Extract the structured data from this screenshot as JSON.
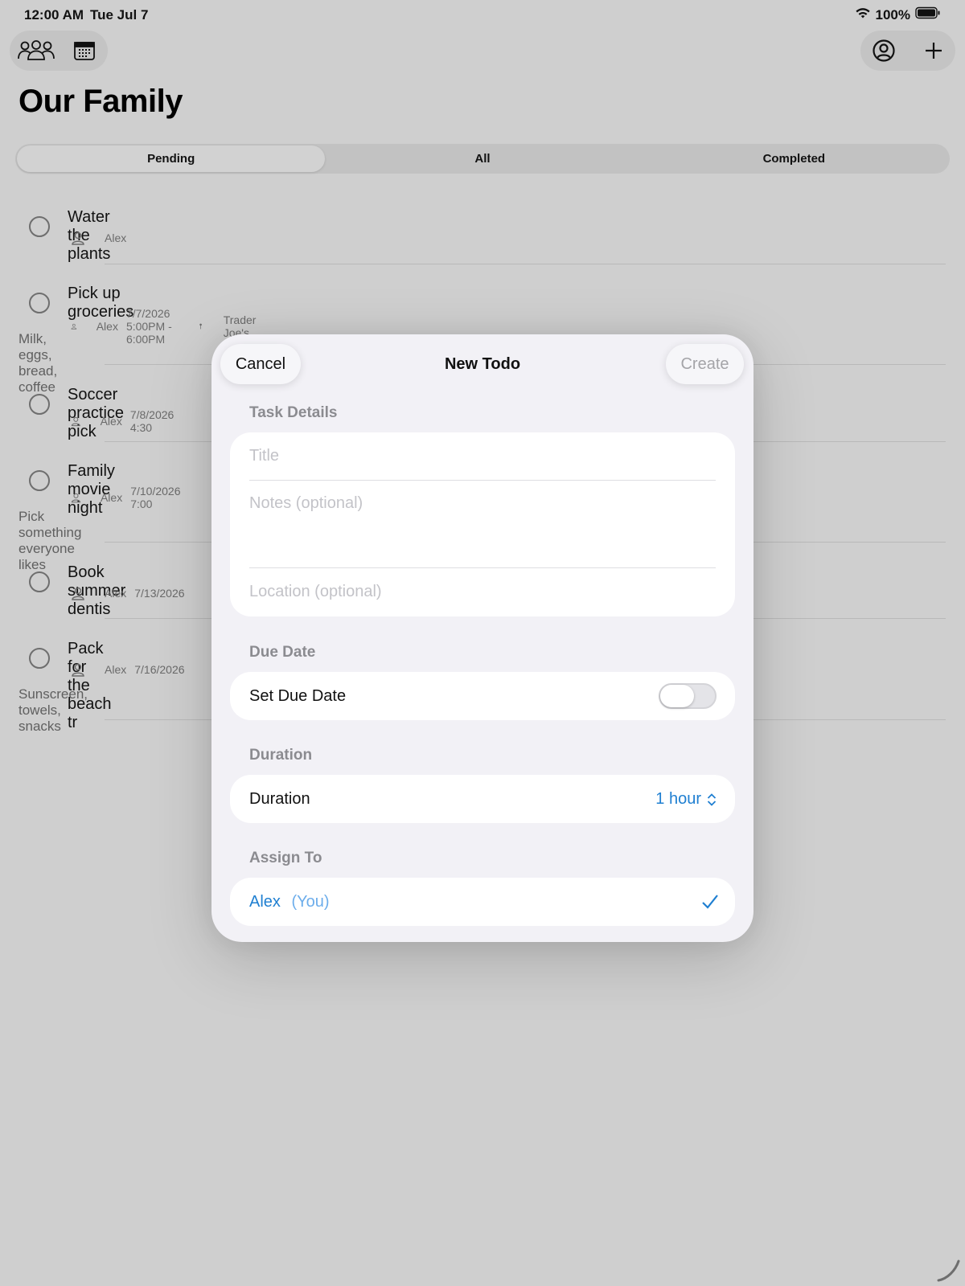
{
  "status_bar": {
    "time": "12:00 AM",
    "date": "Tue Jul 7",
    "battery": "100%"
  },
  "toolbar": {
    "left_icons": [
      "family-icon",
      "calendar-icon"
    ],
    "right_icons": [
      "profile-icon",
      "plus-icon"
    ]
  },
  "page_title": "Our Family",
  "segments": [
    {
      "label": "Pending",
      "selected": true
    },
    {
      "label": "All",
      "selected": false
    },
    {
      "label": "Completed",
      "selected": false
    }
  ],
  "todos": [
    {
      "title": "Water the plants",
      "assignee": "Alex",
      "when": "",
      "location": "",
      "notes": ""
    },
    {
      "title": "Pick up groceries",
      "assignee": "Alex",
      "when": "7/7/2026 5:00PM - 6:00PM",
      "location": "Trader Joe's",
      "notes": "Milk, eggs, bread, coffee"
    },
    {
      "title": "Soccer practice pick",
      "assignee": "Alex",
      "when": "7/8/2026 4:30",
      "location": "",
      "notes": ""
    },
    {
      "title": "Family movie night",
      "assignee": "Alex",
      "when": "7/10/2026 7:00",
      "location": "",
      "notes": "Pick something everyone likes"
    },
    {
      "title": "Book summer dentis",
      "assignee": "Alex",
      "when": "7/13/2026",
      "location": "",
      "notes": ""
    },
    {
      "title": "Pack for the beach tr",
      "assignee": "Alex",
      "when": "7/16/2026",
      "location": "",
      "notes": "Sunscreen, towels, snacks"
    }
  ],
  "modal": {
    "cancel_label": "Cancel",
    "title": "New Todo",
    "create_label": "Create",
    "task_details": {
      "section_label": "Task Details",
      "title_placeholder": "Title",
      "notes_placeholder": "Notes (optional)",
      "location_placeholder": "Location (optional)"
    },
    "due_date": {
      "section_label": "Due Date",
      "row_label": "Set Due Date",
      "enabled": false
    },
    "duration": {
      "section_label": "Duration",
      "row_label": "Duration",
      "value": "1 hour"
    },
    "assign_to": {
      "section_label": "Assign To",
      "name": "Alex",
      "suffix": "(You)",
      "checked": true
    }
  },
  "colors": {
    "accent": "#1f7fd1",
    "background": "#cfcfcf",
    "modal_background": "#f2f1f6"
  }
}
